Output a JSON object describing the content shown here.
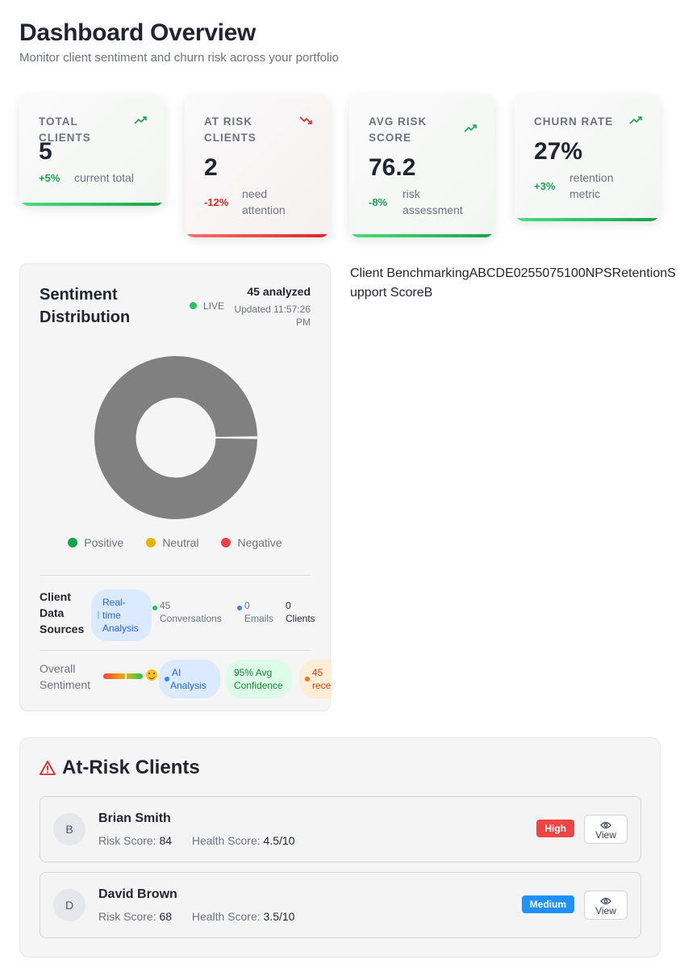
{
  "header": {
    "title": "Dashboard Overview",
    "subtitle": "Monitor client sentiment and churn risk across your portfolio"
  },
  "kpis": [
    {
      "label": "TOTAL CLIENTS",
      "value": "5",
      "change": "+5%",
      "note": "current total",
      "trend": "up",
      "accent": "#16a34a"
    },
    {
      "label": "AT RISK CLIENTS",
      "value": "2",
      "change": "-12%",
      "note": "need attention",
      "trend": "down",
      "accent": "#dc2626"
    },
    {
      "label": "AVG RISK SCORE",
      "value": "76.2",
      "change": "-8%",
      "note": "risk assessment",
      "trend": "up",
      "accent": "#16a34a"
    },
    {
      "label": "CHURN RATE",
      "value": "27%",
      "change": "+3%",
      "note": "retention metric",
      "trend": "up",
      "accent": "#16a34a"
    }
  ],
  "sentiment": {
    "title": "Sentiment Distribution",
    "live_label": "LIVE",
    "analyzed": "45 analyzed",
    "updated": "Updated 11:57:26 PM",
    "legend": [
      {
        "label": "Positive",
        "color": "#16a34a"
      },
      {
        "label": "Neutral",
        "color": "#eab308"
      },
      {
        "label": "Negative",
        "color": "#ef4444"
      }
    ],
    "sources_label": "Client Data Sources",
    "sources_pill": "Real-time Analysis",
    "conversations": "45 Conversations",
    "emails": "0 Emails",
    "clients": "0 Clients",
    "overall_label": "Overall Sentiment",
    "ai_pill": "AI Analysis",
    "confidence_pill": "95% Avg Confidence",
    "recent_pill": "45 rece"
  },
  "benchmark_text": "Client BenchmarkingABCDE0255075100NPSRetentionSupport ScoreB",
  "at_risk": {
    "title": "At-Risk Clients",
    "risk_score_label": "Risk Score:",
    "health_score_label": "Health Score:",
    "view_label": "View",
    "clients": [
      {
        "initial": "B",
        "name": "Brian Smith",
        "risk_score": "84",
        "health_score": "4.5/10",
        "level": "High"
      },
      {
        "initial": "D",
        "name": "David Brown",
        "risk_score": "68",
        "health_score": "3.5/10",
        "level": "Medium"
      }
    ]
  }
}
